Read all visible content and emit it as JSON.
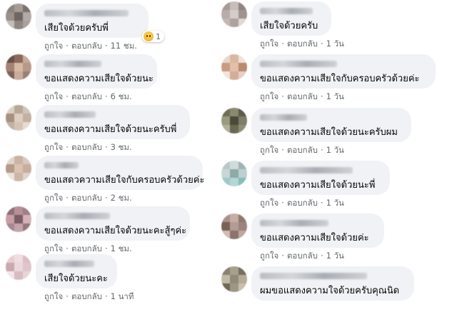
{
  "labels": {
    "like": "ถูกใจ",
    "reply": "ตอบกลับ",
    "dot": "·"
  },
  "left": [
    {
      "text": "เสียใจด้วยครับพี่",
      "time": "11 ชม.",
      "reaction": {
        "icon": "sad-emoji-icon",
        "count": "1"
      }
    },
    {
      "text": "ขอแสดงความเสียใจด้วยนะ",
      "time": "6 ชม."
    },
    {
      "text": "ขอแสดงความเสียใจด้วยนะครับพี่",
      "time": "3 ชม."
    },
    {
      "text": "ขอแสดวความเสียใจกับครอบครัวด้วยค่ะ",
      "time": "2 ชม."
    },
    {
      "text": "ขอแสดงความเสียใจด้วยนะคะสู้ๆค่ะ",
      "time": "1 ชม."
    },
    {
      "text": "เสียใจด้วยนะคะ",
      "time": "1 นาที"
    }
  ],
  "right": [
    {
      "text": "เสียใจด้วยครับ",
      "time": "1 วัน"
    },
    {
      "text": "ขอแสดงความเสียใจกับครอบครัวด้วยค่ะ",
      "time": "1 วัน"
    },
    {
      "text": "ขอแสดงความเสียใจด้วยนะครับผม",
      "time": "1 วัน"
    },
    {
      "text": "ขอแสดงความเสียใจด้วยนะพี่",
      "time": "1 วัน"
    },
    {
      "text": "ขอแสดงความเสียใจด้วยค่ะ",
      "time": "1 วัน"
    },
    {
      "text": "ผมขอแสดงความใจด้วยครับคุณนิด",
      "time": ""
    }
  ]
}
